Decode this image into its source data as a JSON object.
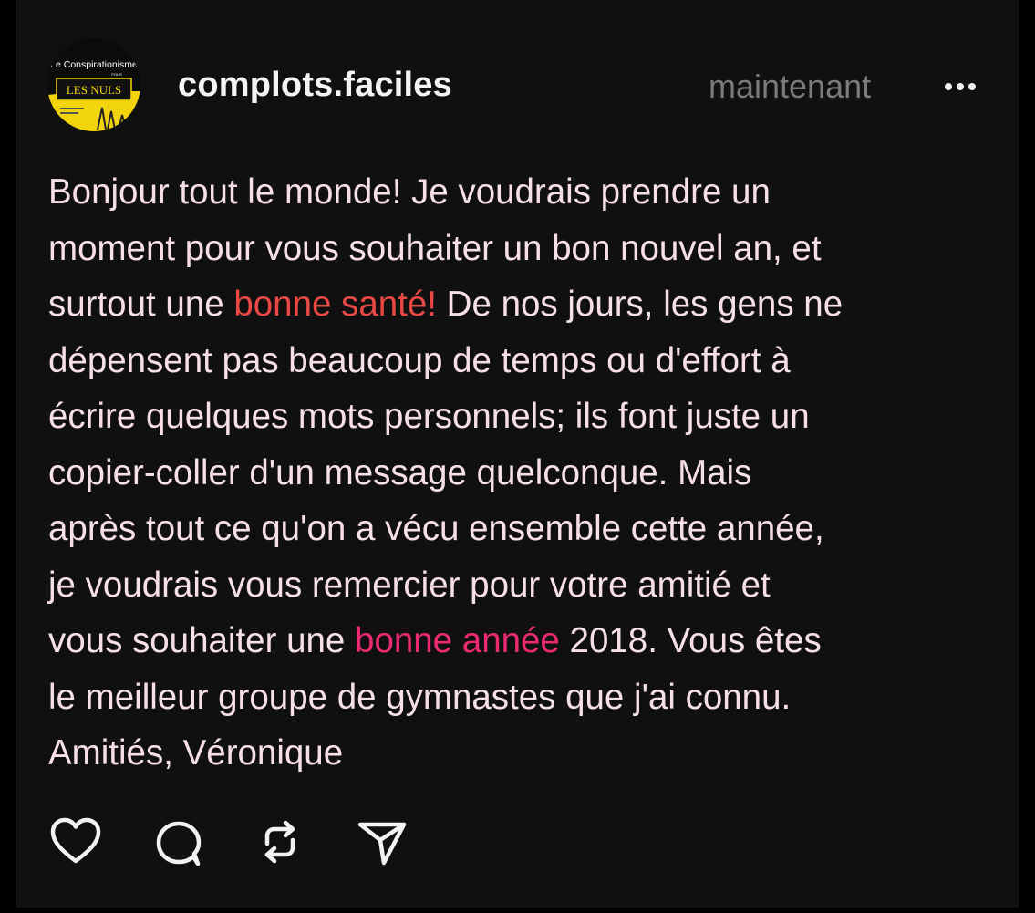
{
  "post": {
    "avatar": {
      "line1": "Le Conspirationisme",
      "line2": "POUR",
      "line3": "LES NULS"
    },
    "username": "complots.faciles",
    "timestamp": "maintenant",
    "more_icon": "more-horizontal-icon",
    "body": {
      "l1": "Bonjour tout le monde! Je voudrais prendre un",
      "l2": "moment pour vous souhaiter un bon nouvel  an, et",
      "l3_a": "surtout une ",
      "l3_hl": "bonne santé!",
      "l3_b": " De nos jours, les gens ne",
      "l4": "dépensent pas beaucoup de temps ou d'effort à",
      "l5": "écrire quelques mots personnels; ils font juste un",
      "l6": "copier-coller d'un message quelconque. Mais",
      "l7": "après tout ce qu'on a vécu ensemble cette année,",
      "l8": "je voudrais vous remercier pour votre amitié et",
      "l9_a": "vous souhaiter une ",
      "l9_hl": "bonne année",
      "l9_b": " 2018. Vous êtes",
      "l10": "le meilleur groupe de gymnastes que j'ai connu.",
      "l11": "Amitiés, Véronique"
    },
    "actions": [
      "heart-icon",
      "comment-icon",
      "repost-icon",
      "share-icon"
    ],
    "colors": {
      "background": "#101010",
      "text": "#f7dfe9",
      "highlight_red": "#ea4845",
      "highlight_pink": "#ec2a72",
      "muted": "#7b7b7b"
    }
  }
}
